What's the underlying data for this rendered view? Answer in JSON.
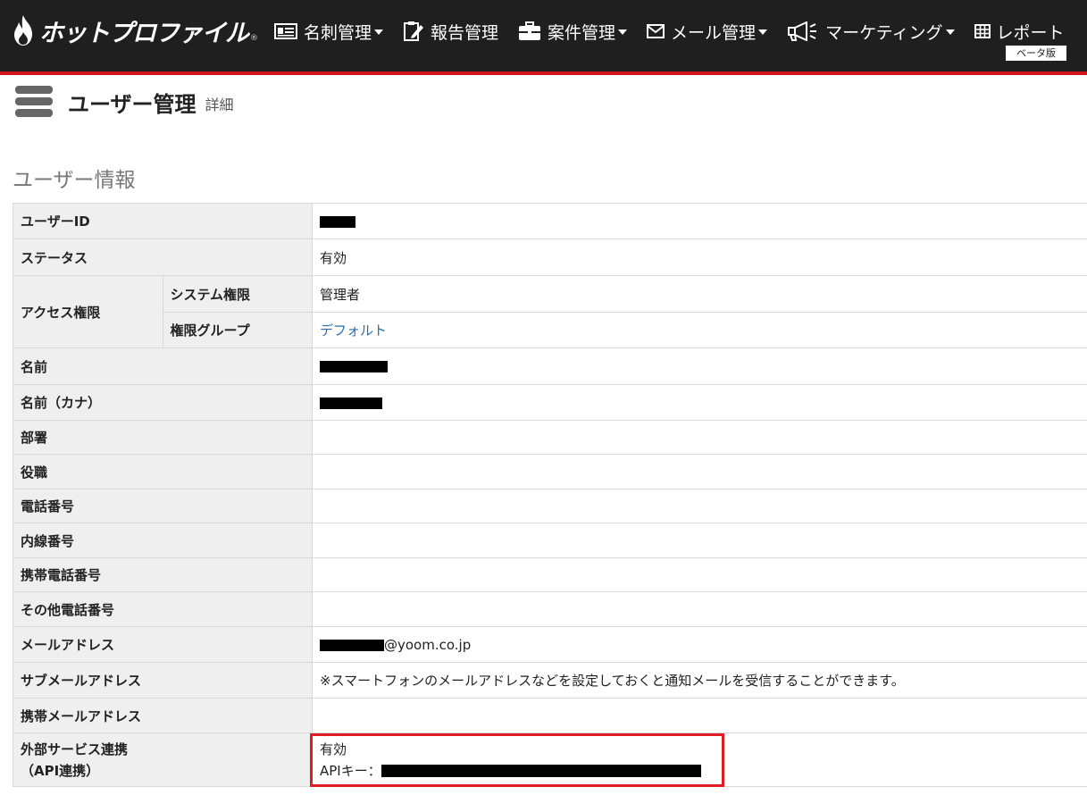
{
  "app": {
    "logo_text": "ホットプロファイル",
    "logo_reg": "®",
    "beta_badge": "ベータ版"
  },
  "nav": [
    {
      "label": "名刺管理",
      "icon": "business-card-icon",
      "dropdown": true
    },
    {
      "label": "報告管理",
      "icon": "report-edit-icon",
      "dropdown": false
    },
    {
      "label": "案件管理",
      "icon": "briefcase-icon",
      "dropdown": true
    },
    {
      "label": "メール管理",
      "icon": "envelope-icon",
      "dropdown": true
    },
    {
      "label": "マーケティング",
      "icon": "megaphone-icon",
      "dropdown": true
    },
    {
      "label": "レポート",
      "icon": "table-grid-icon",
      "dropdown": false
    }
  ],
  "page": {
    "title": "ユーザー管理",
    "subtitle": "詳細",
    "section_title": "ユーザー情報"
  },
  "rows": {
    "user_id": {
      "label": "ユーザーID"
    },
    "status": {
      "label": "ステータス",
      "value": "有効"
    },
    "access": {
      "label": "アクセス権限",
      "system_label": "システム権限",
      "system_value": "管理者",
      "group_label": "権限グループ",
      "group_value": "デフォルト"
    },
    "name": {
      "label": "名前"
    },
    "name_kana": {
      "label": "名前（カナ）"
    },
    "department": {
      "label": "部署"
    },
    "position": {
      "label": "役職"
    },
    "phone": {
      "label": "電話番号"
    },
    "extension": {
      "label": "内線番号"
    },
    "mobile": {
      "label": "携帯電話番号"
    },
    "other_phone": {
      "label": "その他電話番号"
    },
    "email": {
      "label": "メールアドレス",
      "domain": "@yoom.co.jp"
    },
    "sub_email": {
      "label": "サブメールアドレス",
      "note": "※スマートフォンのメールアドレスなどを設定しておくと通知メールを受信することができます。"
    },
    "mobile_email": {
      "label": "携帯メールアドレス"
    },
    "api": {
      "label_line1": "外部サービス連携",
      "label_line2": "（API連携）",
      "status": "有効",
      "key_label": "APIキー："
    }
  },
  "colors": {
    "header_bg": "#1f1f1f",
    "header_accent": "#d0161c",
    "highlight_box": "#e01c24",
    "link": "#2a6db0",
    "note": "#b03030"
  }
}
